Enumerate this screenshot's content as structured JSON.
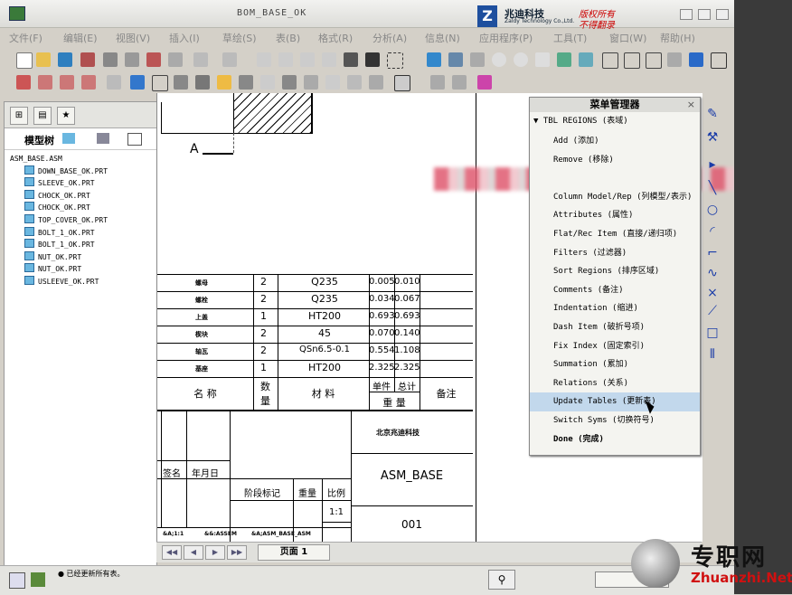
{
  "window": {
    "title": "BOM_BASE_OK",
    "brand_logo": "Z",
    "brand_cn": "兆迪科技",
    "brand_en": "Zaldy Technology Co.,Ltd.",
    "brand_right1": "版权所有",
    "brand_right2": "不得翻录"
  },
  "menubar": [
    "文件(F)",
    "编辑(E)",
    "视图(V)",
    "插入(I)",
    "草绘(S)",
    "表(B)",
    "格式(R)",
    "分析(A)",
    "信息(N)",
    "应用程序(P)",
    "工具(T)",
    "窗口(W)",
    "帮助(H)"
  ],
  "sidebar": {
    "tabs": [
      "model-tree",
      "folder",
      "favorites"
    ],
    "toolbar_label": "模型树",
    "tree": [
      "ASM_BASE.ASM",
      "DOWN_BASE_OK.PRT",
      "SLEEVE_OK.PRT",
      "CHOCK_OK.PRT",
      "CHOCK_OK.PRT",
      "TOP_COVER_OK.PRT",
      "BOLT_1_OK.PRT",
      "BOLT_1_OK.PRT",
      "NUT_OK.PRT",
      "NUT_OK.PRT",
      "USLEEVE_OK.PRT"
    ]
  },
  "drawing": {
    "section_label": "A",
    "bom_rows": [
      {
        "name": "螺母",
        "qty": "2",
        "mat": "Q235",
        "unit": "0.005",
        "total": "0.010"
      },
      {
        "name": "螺栓",
        "qty": "2",
        "mat": "Q235",
        "unit": "0.034",
        "total": "0.067"
      },
      {
        "name": "上盖",
        "qty": "1",
        "mat": "HT200",
        "unit": "0.693",
        "total": "0.693"
      },
      {
        "name": "楔块",
        "qty": "2",
        "mat": "45",
        "unit": "0.070",
        "total": "0.140"
      },
      {
        "name": "轴瓦",
        "qty": "2",
        "mat": "QSn6.5-0.1",
        "unit": "0.554",
        "total": "1.108"
      },
      {
        "name": "基座",
        "qty": "1",
        "mat": "HT200",
        "unit": "2.325",
        "total": "2.325"
      }
    ],
    "header": {
      "name": "名    称",
      "qty1": "数",
      "qty2": "量",
      "mat": "材    料",
      "unit": "单件",
      "total": "总计",
      "weight": "重    量",
      "remark": "备注"
    },
    "title_block": {
      "company": "北京兆迪科技",
      "part": "ASM_BASE",
      "number": "001",
      "sign": "签名",
      "date": "年月日",
      "stage": "阶段标记",
      "weight": "重量",
      "scale": "比例",
      "scale_value": "1:1",
      "footer1": "&A;1:1",
      "footer2": "&&:ASSEM",
      "footer3": "&A;ASM_BASE_ASM"
    }
  },
  "menu_manager": {
    "title": "菜单管理器",
    "submenu": "▼ TBL REGIONS (表域)",
    "items": [
      "Add (添加)",
      "Remove (移除)",
      "",
      "Column Model/Rep (列模型/表示)",
      "Attributes (属性)",
      "Flat/Rec Item (直接/递归项)",
      "Filters (过滤器)",
      "Sort Regions (排序区域)",
      "Comments (备注)",
      "Indentation (缩进)",
      "Dash Item (破折号项)",
      "Fix Index (固定索引)",
      "Summation (累加)",
      "Relations (关系)",
      "Update Tables (更新表)",
      "Switch Syms (切换符号)",
      "Done (完成)"
    ],
    "highlight_index": 14
  },
  "pagebar": {
    "page_label": "页面 1"
  },
  "statusbar": {
    "message": "● 已经更新所有表。"
  },
  "watermark": {
    "cn": "专职网",
    "en": "Zhuanzhi.Net"
  }
}
